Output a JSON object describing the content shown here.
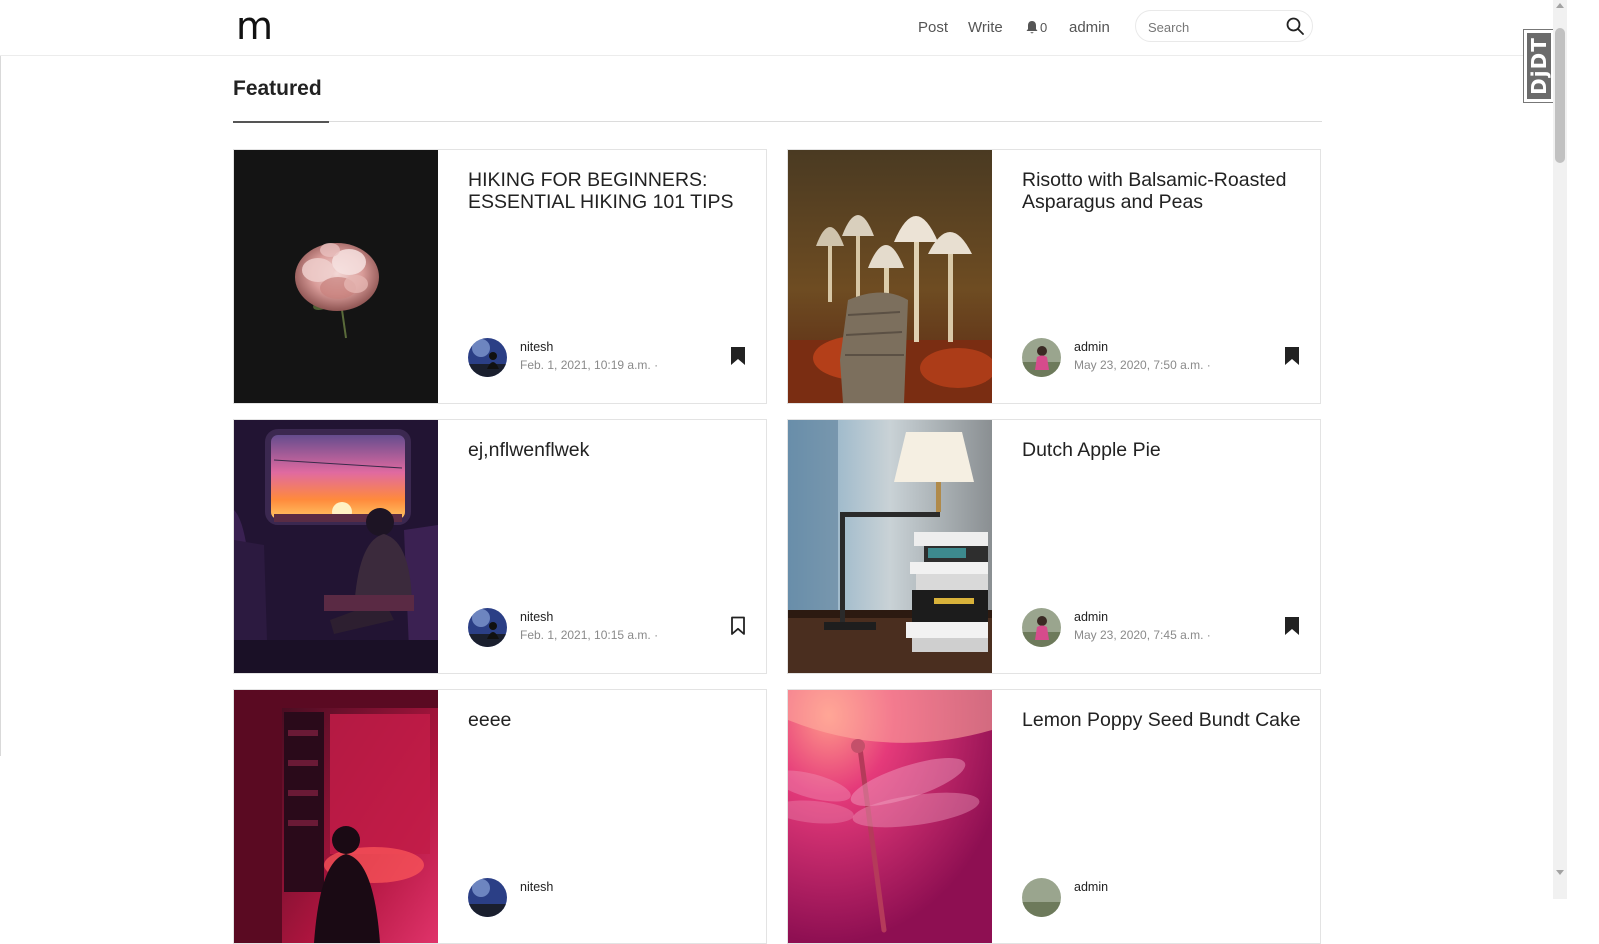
{
  "header": {
    "logo": "m",
    "nav": {
      "post": "Post",
      "write": "Write",
      "notifications_count": "0",
      "user": "admin"
    },
    "search": {
      "placeholder": "Search"
    }
  },
  "featured": {
    "title": "Featured",
    "posts": [
      {
        "title": "HIKING FOR BEGINNERS: ESSENTIAL HIKING 101 TIPS",
        "author": "nitesh",
        "date": "Feb. 1, 2021, 10:19 a.m. ·",
        "bookmarked": true,
        "image": "pink-peony-on-black"
      },
      {
        "title": "Risotto with Balsamic-Roasted Asparagus and Peas",
        "author": "admin",
        "date": "May 23, 2020, 7:50 a.m. ·",
        "bookmarked": true,
        "image": "mushrooms-closeup"
      },
      {
        "title": "ej,nflwenflwek",
        "author": "nitesh",
        "date": "Feb. 1, 2021, 10:15 a.m. ·",
        "bookmarked": false,
        "image": "train-window-sunset"
      },
      {
        "title": "Dutch Apple Pie",
        "author": "admin",
        "date": "May 23, 2020, 7:45 a.m. ·",
        "bookmarked": true,
        "image": "desk-lamp-books"
      },
      {
        "title": "eeee",
        "author": "nitesh",
        "date": "",
        "bookmarked": false,
        "image": "red-room-illustration"
      },
      {
        "title": "Lemon Poppy Seed Bundt Cake",
        "author": "admin",
        "date": "",
        "bookmarked": false,
        "image": "pink-dragonfly"
      }
    ]
  },
  "devtools": {
    "label": "DjDT"
  },
  "colors": {
    "text": "#222222",
    "muted": "#8a8a8a",
    "border": "#e3e3e3",
    "accent": "#555555"
  }
}
